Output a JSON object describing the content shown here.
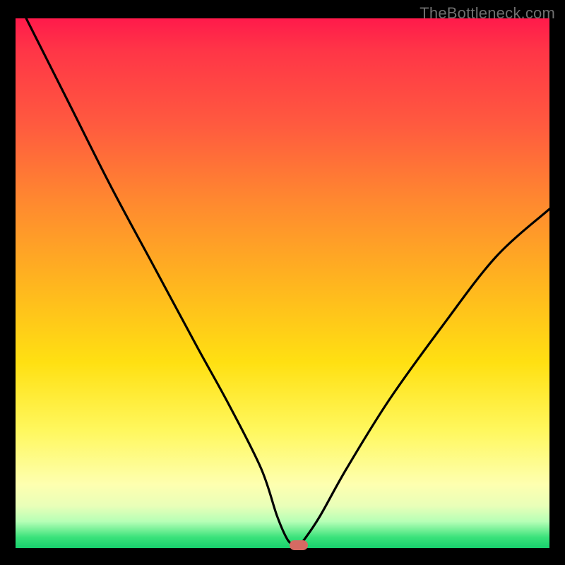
{
  "watermark": "TheBottleneck.com",
  "chart_data": {
    "type": "line",
    "title": "",
    "xlabel": "",
    "ylabel": "",
    "xlim": [
      0,
      100
    ],
    "ylim": [
      0,
      100
    ],
    "grid": false,
    "series": [
      {
        "name": "bottleneck-curve",
        "x": [
          2,
          10,
          18,
          26,
          34,
          40,
          46,
          49,
          51,
          52.5,
          53,
          54,
          57,
          62,
          70,
          80,
          90,
          100
        ],
        "values": [
          100,
          84,
          68,
          53,
          38,
          27,
          15,
          6,
          1.5,
          0.5,
          0.5,
          1.5,
          6,
          15,
          28,
          42,
          55,
          64
        ]
      }
    ],
    "marker": {
      "x": 53,
      "y": 0.5
    },
    "background_gradient": {
      "direction": "vertical",
      "stops": [
        {
          "pos": 0,
          "color": "#ff1a4b"
        },
        {
          "pos": 35,
          "color": "#ff8a2f"
        },
        {
          "pos": 65,
          "color": "#ffe012"
        },
        {
          "pos": 92,
          "color": "#e9ffb8"
        },
        {
          "pos": 100,
          "color": "#18cf6d"
        }
      ]
    }
  }
}
